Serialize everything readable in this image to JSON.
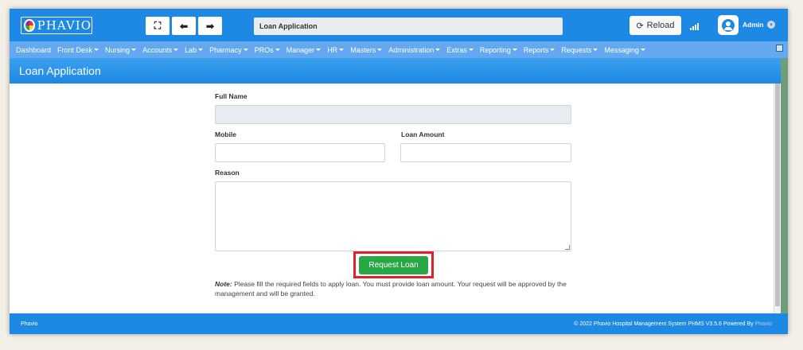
{
  "header": {
    "logo_text": "PHAVIO",
    "page_title": "Loan Application",
    "reload_label": "Reload",
    "admin_label": "Admin",
    "icons": [
      "expand-icon",
      "arrow-left-icon",
      "arrow-right-icon",
      "refresh-icon",
      "signal-icon",
      "user-icon",
      "chevron-down-icon"
    ]
  },
  "menu": {
    "items": [
      {
        "label": "Dashboard",
        "caret": false
      },
      {
        "label": "Front Desk",
        "caret": true
      },
      {
        "label": "Nursing",
        "caret": true
      },
      {
        "label": "Accounts",
        "caret": true
      },
      {
        "label": "Lab",
        "caret": true
      },
      {
        "label": "Pharmacy",
        "caret": true
      },
      {
        "label": "PROs",
        "caret": true
      },
      {
        "label": "Manager",
        "caret": true
      },
      {
        "label": "HR",
        "caret": true
      },
      {
        "label": "Masters",
        "caret": true
      },
      {
        "label": "Administration",
        "caret": true
      },
      {
        "label": "Extras",
        "caret": true
      },
      {
        "label": "Reporting",
        "caret": true
      },
      {
        "label": "Reports",
        "caret": true
      },
      {
        "label": "Requests",
        "caret": true
      },
      {
        "label": "Messaging",
        "caret": true
      }
    ]
  },
  "section_title": "Loan Application",
  "form": {
    "full_name_label": "Full Name",
    "full_name_value": "",
    "mobile_label": "Mobile",
    "mobile_value": "",
    "loan_amount_label": "Loan Amount",
    "loan_amount_value": "",
    "reason_label": "Reason",
    "reason_value": "",
    "submit_label": "Request Loan",
    "note_prefix": "Note:",
    "note_text": " Please fill the required fields to apply loan. You must provide loan amount. Your request will be approved by the management and will be granted."
  },
  "footer": {
    "left": "Phavio",
    "right_text": "© 2022 Phavio Hospital Management System PHMS V3.5.6 Powered By",
    "right_brand": "Phavio"
  },
  "colors": {
    "primary": "#1e88e5",
    "menu": "#64a8f0",
    "success": "#28a745",
    "highlight": "#e0202a"
  }
}
